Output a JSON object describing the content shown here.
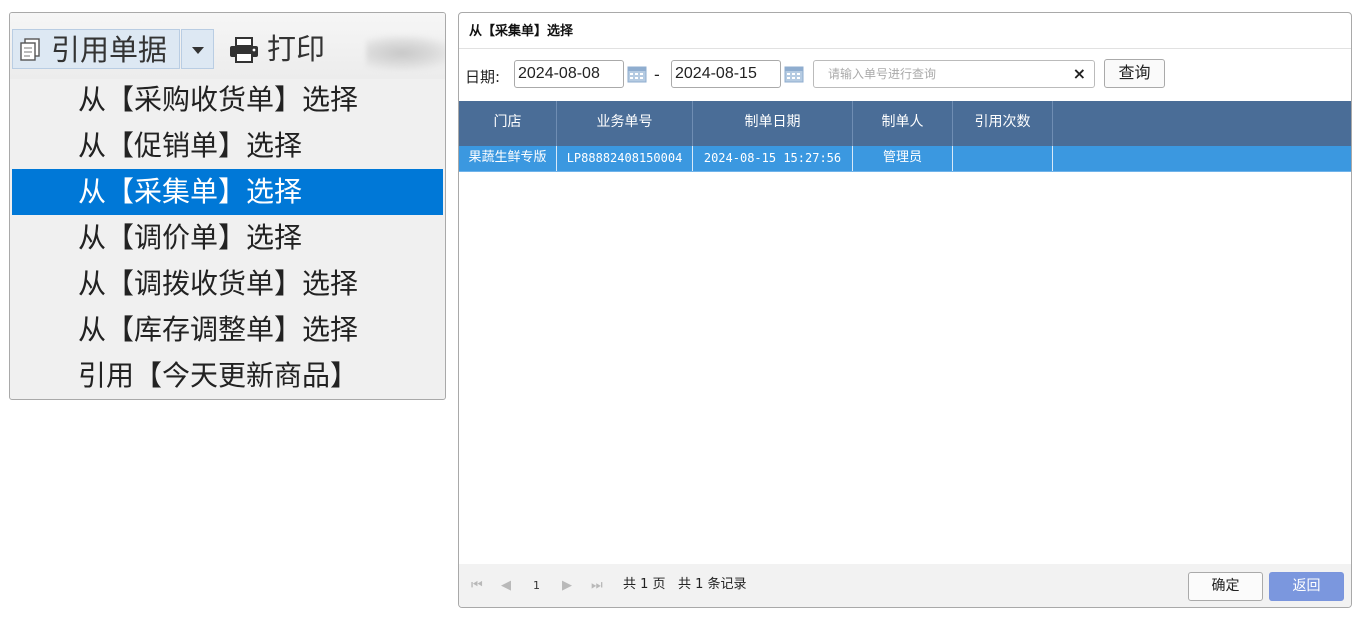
{
  "toolbar": {
    "cite_label": "引用单据",
    "print_label": "打印"
  },
  "menu": {
    "items": [
      "从【采购收货单】选择",
      "从【促销单】选择",
      "从【采集单】选择",
      "从【调价单】选择",
      "从【调拨收货单】选择",
      "从【库存调整单】选择",
      "引用【今天更新商品】"
    ],
    "selected_index": 2
  },
  "dialog": {
    "title": "从【采集单】选择",
    "date_label": "日期:",
    "date_from": "2024-08-08",
    "date_separator": "-",
    "date_to": "2024-08-15",
    "search_placeholder": "请输入单号进行查询",
    "clear_icon": "×",
    "query_button": "查询",
    "columns": [
      "门店",
      "业务单号",
      "制单日期",
      "制单人",
      "引用次数",
      ""
    ],
    "rows": [
      {
        "store": "果蔬生鲜专版",
        "order_no": "LP88882408150004",
        "created_at": "2024-08-15 15:27:56",
        "creator": "管理员",
        "cite_count": ""
      }
    ],
    "pager": {
      "first": "⏮",
      "prev": "◀",
      "page": "1",
      "next": "▶",
      "last": "⏭",
      "pages_text": "共 1 页",
      "records_text": "共 1 条记录"
    },
    "ok_button": "确定",
    "back_button": "返回"
  },
  "colors": {
    "menu_selected": "#0078d7",
    "grid_header": "#4a6d97",
    "grid_row_selected": "#3b98e0",
    "back_button": "#7b97de"
  }
}
